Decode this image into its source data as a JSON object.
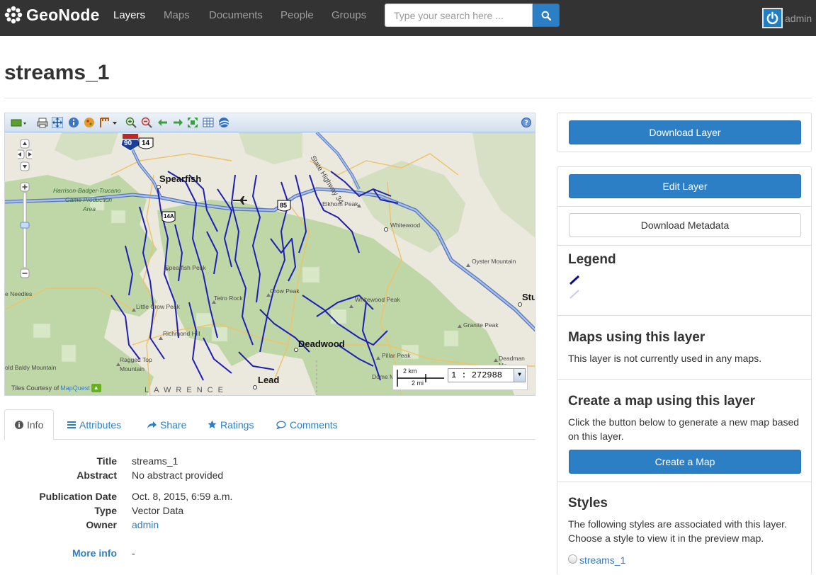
{
  "brand": {
    "name": "GeoNode"
  },
  "nav": {
    "items": [
      {
        "label": "Layers",
        "active": true
      },
      {
        "label": "Maps"
      },
      {
        "label": "Documents"
      },
      {
        "label": "People"
      },
      {
        "label": "Groups"
      }
    ]
  },
  "search": {
    "placeholder": "Type your search here ...",
    "icon": "search-icon"
  },
  "user": {
    "name": "admin",
    "icon": "power-icon"
  },
  "page": {
    "title": "streams_1"
  },
  "map": {
    "toolbar_icons": [
      "layers-icon",
      "print-icon",
      "pan-icon",
      "info-icon",
      "query-icon",
      "measure-icon",
      "zoom-in-icon",
      "zoom-out-icon",
      "back-icon",
      "forward-icon",
      "zoom-extent-icon",
      "grid-icon",
      "globe-icon",
      "help-icon"
    ],
    "labels": {
      "spearfish": "Spearfish",
      "deadwood": "Deadwood",
      "lead": "Lead",
      "whitewood": "Whitewood",
      "stu": "Stu",
      "harrison": "Harrison-Badger-Trucano",
      "game": "Game Production",
      "area": "Area",
      "elkhorn": "Elkhorn Peak",
      "oyster": "Oyster Mountain",
      "whitewood_peak": "Whitewood Peak",
      "granite": "Granite Peak",
      "spearfish_peak": "Spearfish Peak",
      "needles": "e Needles",
      "little_crow": "Little Crow Peak",
      "tetro": "Tetro Rock",
      "crow_peak": "Crow Peak",
      "richmond": "Richmond Hill",
      "ragged1": "Ragged Top",
      "ragged2": "Mountain",
      "bald": "old Baldy Mountain",
      "pillar": "Pillar Peak",
      "dome": "Dome M",
      "deadman": "Deadman Mo",
      "state_hwy": "State Highway 34",
      "lawrence": "LAWRENCE",
      "i90": "90",
      "us14": "14",
      "us85": "85",
      "us14a": "14A"
    },
    "scale": {
      "km": "2 km",
      "mi": "2 mi",
      "ratio": "1 : 272988"
    },
    "credit": {
      "prefix": "Tiles Courtesy of",
      "provider": "MapQuest"
    }
  },
  "tabs": [
    {
      "label": "Info",
      "icon": "info-circle-icon",
      "active": true
    },
    {
      "label": "Attributes",
      "icon": "list-icon"
    },
    {
      "label": "Share",
      "icon": "share-icon"
    },
    {
      "label": "Ratings",
      "icon": "star-icon"
    },
    {
      "label": "Comments",
      "icon": "comment-icon"
    }
  ],
  "info": {
    "title_label": "Title",
    "title_value": "streams_1",
    "abstract_label": "Abstract",
    "abstract_value": "No abstract provided",
    "pubdate_label": "Publication Date",
    "pubdate_value": "Oct. 8, 2015, 6:59 a.m.",
    "type_label": "Type",
    "type_value": "Vector Data",
    "owner_label": "Owner",
    "owner_value": "admin",
    "more_label": "More info",
    "more_value": "-"
  },
  "sidebar": {
    "download_layer": "Download Layer",
    "edit_layer": "Edit Layer",
    "download_metadata": "Download Metadata",
    "legend_heading": "Legend",
    "legend_colors": [
      "#0c0c8c",
      "#c9c9f0"
    ],
    "maps_heading": "Maps using this layer",
    "maps_text": "This layer is not currently used in any maps.",
    "create_heading": "Create a map using this layer",
    "create_text": "Click the button below to generate a new map based on this layer.",
    "create_button": "Create a Map",
    "styles_heading": "Styles",
    "styles_text": "The following styles are associated with this layer. Choose a style to view it in the preview map.",
    "style_name": "streams_1"
  },
  "colors": {
    "navbar": "#333333",
    "accent": "#2c7fc4",
    "stream": "#1f1fb4",
    "forest": "#b9d2a0",
    "road": "#8aa9d8"
  }
}
